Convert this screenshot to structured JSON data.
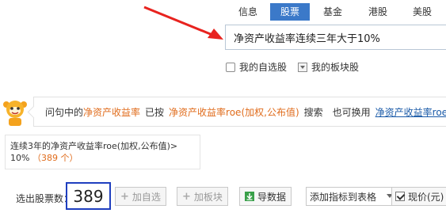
{
  "tabs": [
    {
      "label": "信息",
      "active": false
    },
    {
      "label": "股票",
      "active": true
    },
    {
      "label": "基金",
      "active": false
    },
    {
      "label": "港股",
      "active": false
    },
    {
      "label": "美股",
      "active": false
    }
  ],
  "search": {
    "value": "净资产收益率连续三年大于10%"
  },
  "options": {
    "my_watchlist": "我的自选股",
    "my_sector_stocks": "我的板块股"
  },
  "assistant": {
    "part1": "问句中的",
    "term1": "净资产收益率",
    "part2": "已按",
    "term2": "净资产收益率roe(加权,公布值)",
    "part3": "搜索",
    "part4": "也可换用",
    "alt_link": "净资产收益率roe(摊"
  },
  "condition": {
    "line1": "连续3年的净资产收益率roe(加权,公布值)>",
    "value": "10%",
    "count": "（389 个）"
  },
  "toolbar": {
    "label": "选出股票数：",
    "count": "389",
    "add_watch": "加自选",
    "add_sector": "加板块",
    "export": "导数据",
    "add_indicator": "添加指标到表格",
    "current_price": "现价(元)"
  },
  "colors": {
    "accent": "#3b79c9",
    "highlight_border": "#1f3fbf",
    "term": "#e06c1c",
    "arrow": "#e8231f"
  }
}
